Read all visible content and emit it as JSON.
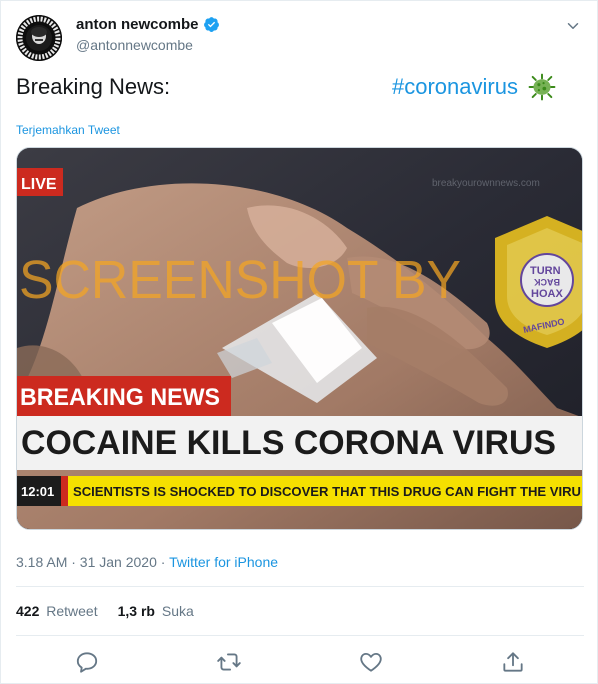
{
  "user": {
    "display_name": "anton newcombe",
    "handle": "@antonnewcombe",
    "verified": true,
    "avatar_text": "MASSACRE THE BRIAN JONESTOWN"
  },
  "tweet": {
    "text": "Breaking News:",
    "hashtag": "#coronavirus",
    "emoji": "microbe-emoji",
    "translate_label": "Terjemahkan Tweet"
  },
  "media": {
    "live_label": "LIVE",
    "watermark_url": "breakyourownnews.com",
    "overlay_text": "SCREENSHOT BY",
    "stamp_lines": [
      "TURN",
      "BACK",
      "HOAX"
    ],
    "stamp_ring_top": "MASYARAKAT ANTI FITNAH INDONESIA",
    "stamp_ring_bottom": "MAFINDO",
    "breaking_label": "BREAKING NEWS",
    "headline": "COCAINE KILLS CORONA VIRUS",
    "clock": "12:01",
    "ticker": "SCIENTISTS IS SHOCKED TO DISCOVER THAT THIS DRUG CAN FIGHT THE VIRU"
  },
  "meta": {
    "time": "3.18 AM · 31 Jan 2020 · ",
    "source": "Twitter for iPhone"
  },
  "stats": {
    "retweets_count": "422",
    "retweets_label": "Retweet",
    "likes_count": "1,3 rb",
    "likes_label": "Suka"
  },
  "colors": {
    "link": "#1b95e0",
    "text": "#14171a",
    "muted": "#657786",
    "verified": "#1da1f2",
    "cnn_red": "#cc2a1f",
    "ticker_yellow": "#f5e000",
    "stamp_gold": "#e8c020",
    "stamp_purple": "#6a4aa8"
  }
}
